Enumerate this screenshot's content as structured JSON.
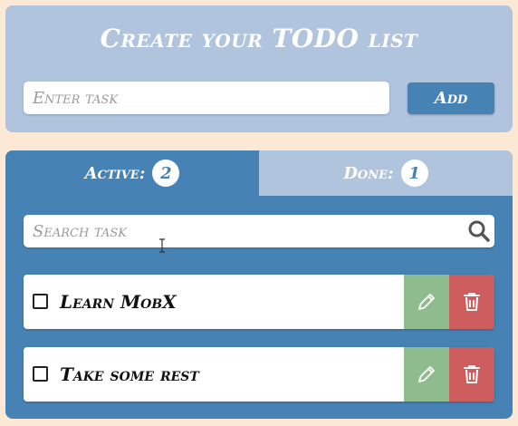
{
  "create": {
    "title": "Create your TODO list",
    "input_placeholder": "Enter task",
    "input_value": "",
    "add_label": "Add"
  },
  "tabs": [
    {
      "label": "Active:",
      "count": "2",
      "selected": true
    },
    {
      "label": "Done:",
      "count": "1",
      "selected": false
    }
  ],
  "search": {
    "placeholder": "Search task",
    "value": "",
    "icon": "search-icon"
  },
  "tasks": [
    {
      "label": "Learn MobX",
      "checked": false
    },
    {
      "label": "Take some rest",
      "checked": false
    }
  ],
  "colors": {
    "page_bg": "#fbe9d6",
    "panel_light": "#b0c4de",
    "panel_dark": "#4682b4",
    "edit": "#8fbc8f",
    "delete": "#cd5c5c"
  }
}
